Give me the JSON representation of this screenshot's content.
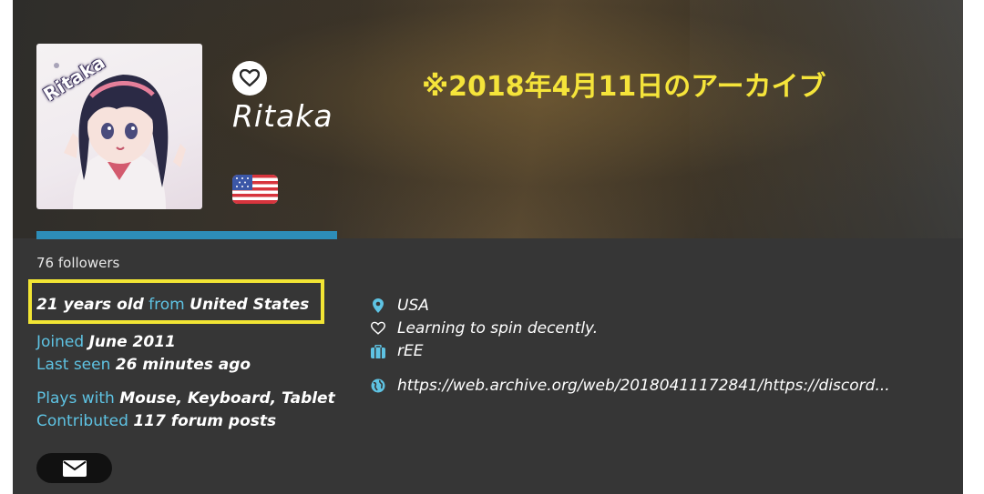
{
  "header": {
    "avatar_name": "Ritaka",
    "username": "Ritaka",
    "archive_note": "※2018年4月11日のアーカイブ",
    "flag_icon": "us-flag-icon"
  },
  "profile": {
    "followers": "76 followers",
    "age": "21 years old",
    "from_label": "from",
    "country": "United States",
    "joined_label": "Joined",
    "joined_value": "June 2011",
    "last_seen_label": "Last seen",
    "last_seen_value": "26 minutes ago",
    "plays_label": "Plays with",
    "plays_value": "Mouse, Keyboard, Tablet",
    "contributed_label": "Contributed",
    "contributed_value": "117 forum posts"
  },
  "info": {
    "location": "USA",
    "interests": "Learning to spin decently.",
    "occupation": "rEE",
    "website": "https://web.archive.org/web/20180411172841/https://discord..."
  },
  "colors": {
    "accent_blue": "#2d8db8",
    "label_blue": "#5ec3e3",
    "highlight_yellow": "#f2e534",
    "card_bg": "#363636"
  }
}
